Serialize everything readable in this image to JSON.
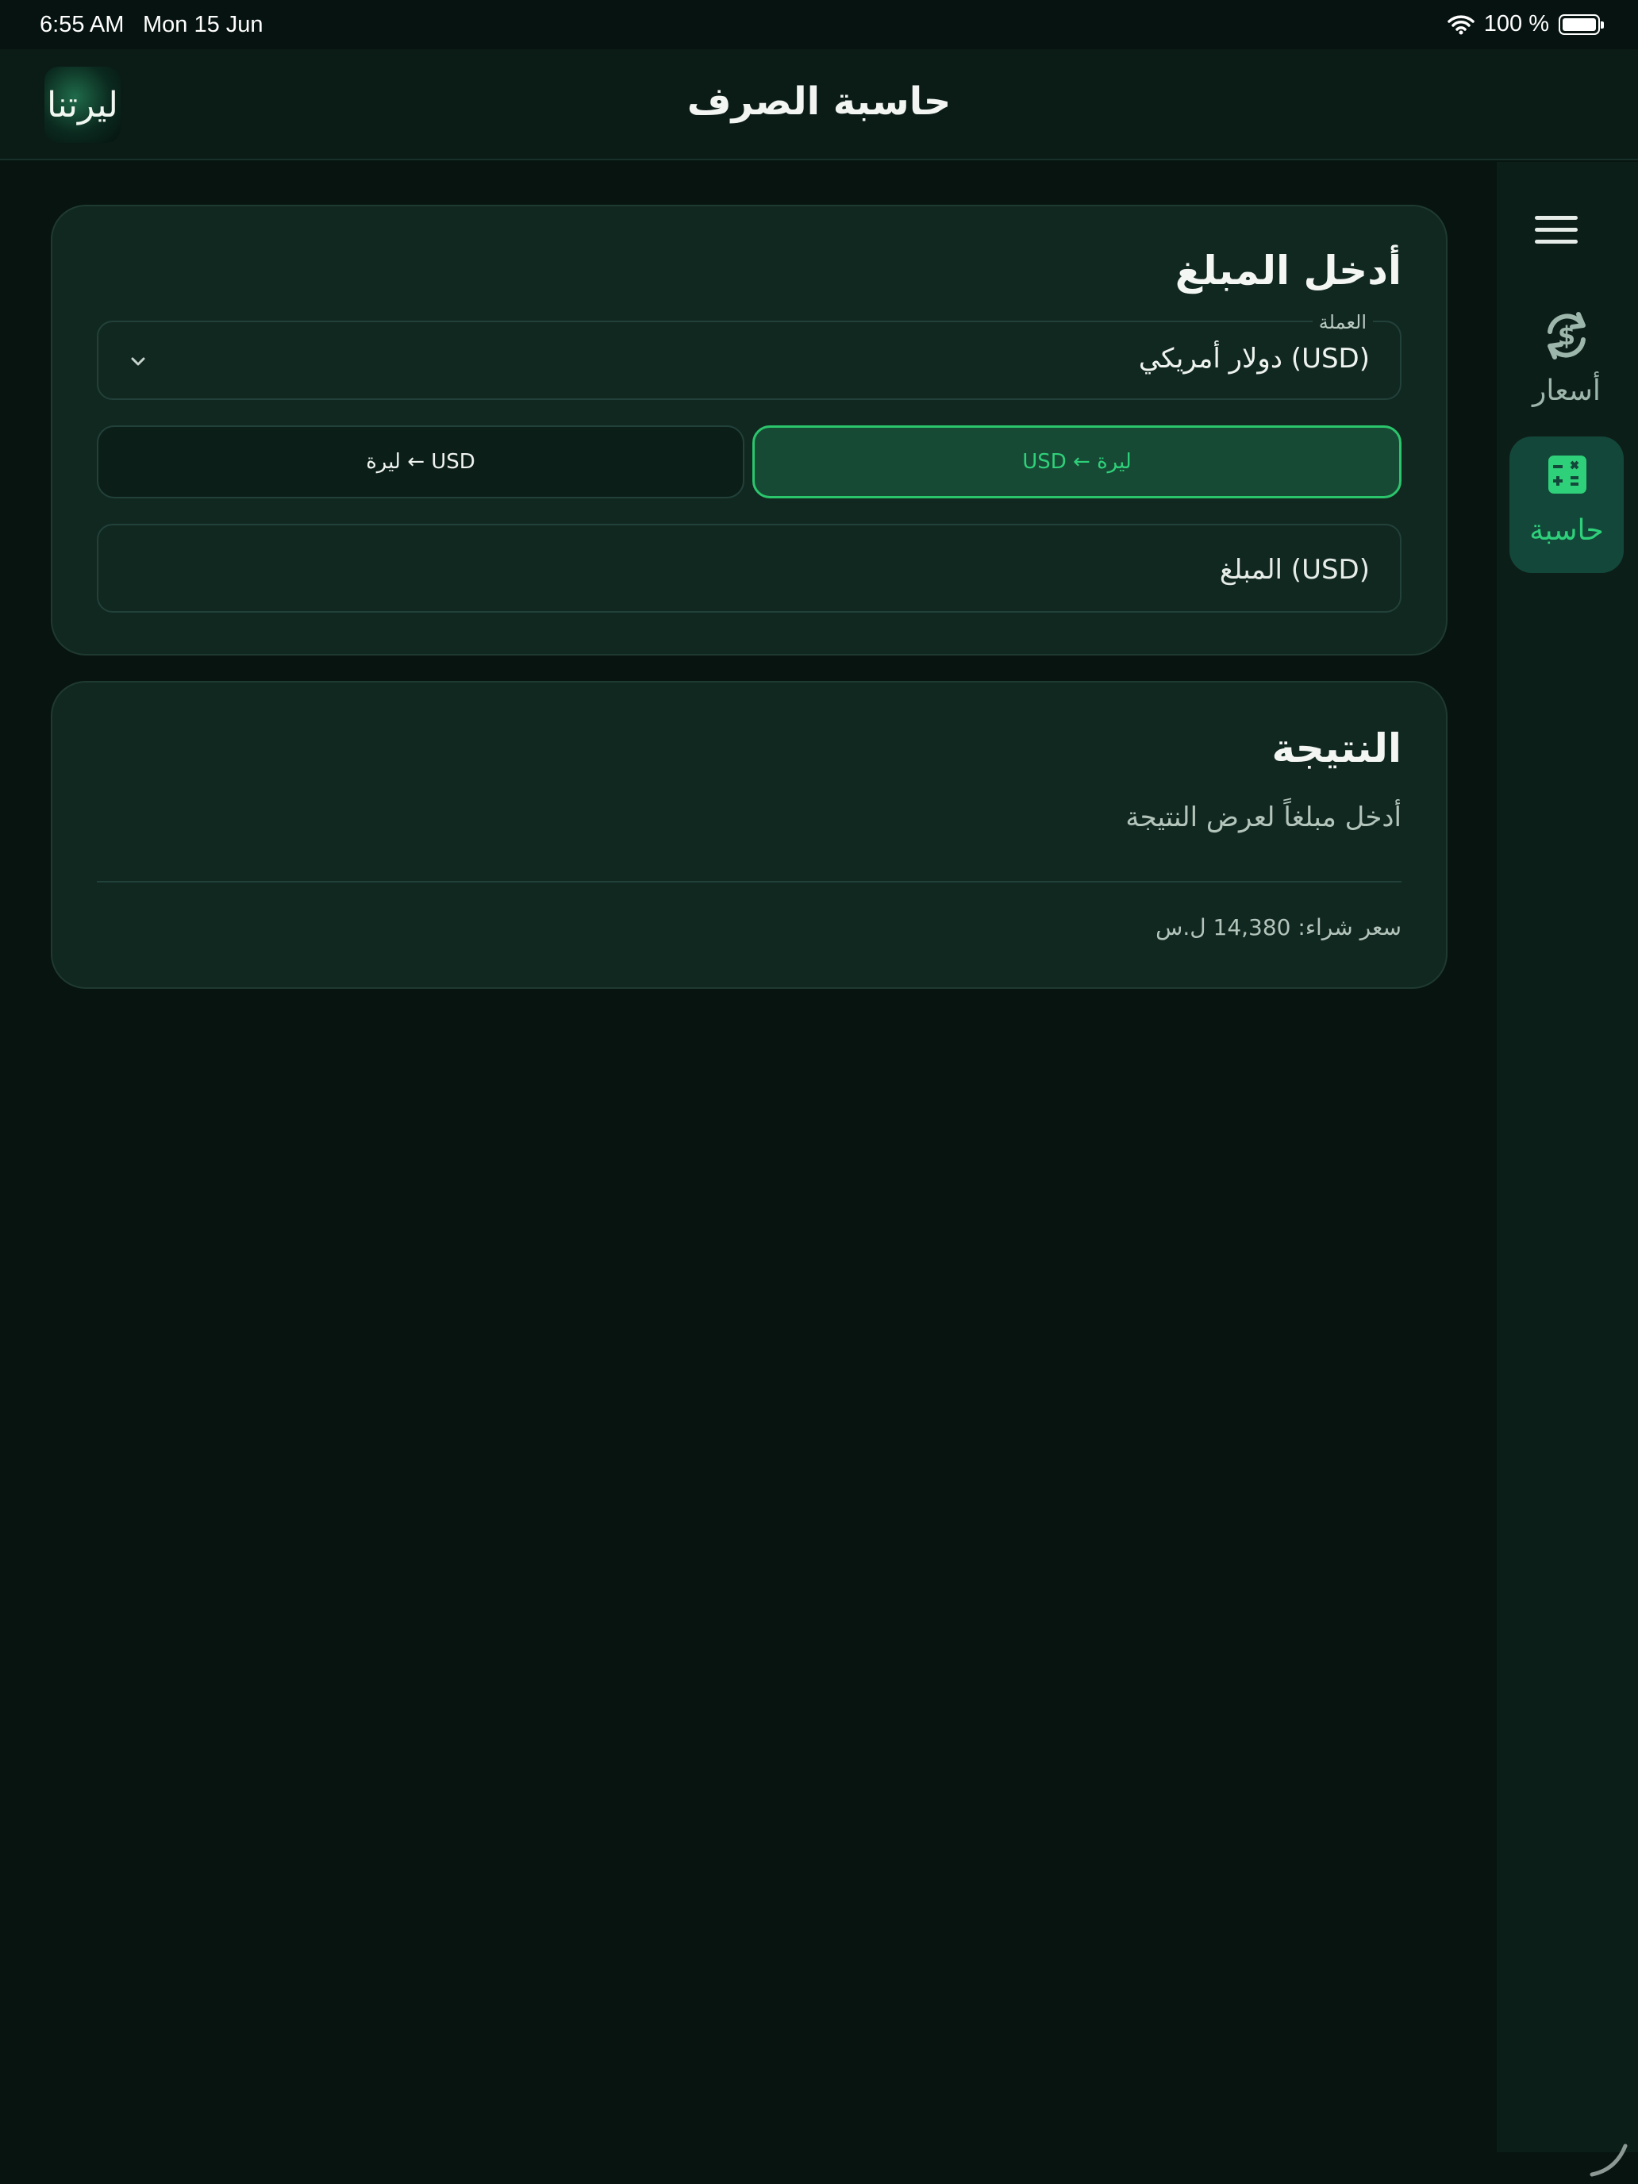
{
  "status_bar": {
    "time": "6:55 AM",
    "date": "Mon 15 Jun",
    "battery": "100 %"
  },
  "header": {
    "title": "حاسبة الصرف",
    "logo_text": "ليرتنا"
  },
  "side_rail": {
    "items": [
      {
        "label": "أسعار",
        "icon": "dollar-exchange-icon"
      },
      {
        "label": "حاسبة",
        "icon": "calculator-icon",
        "active": true
      }
    ]
  },
  "input_card": {
    "title": "أدخل المبلغ",
    "currency_legend": "العملة",
    "currency_value": "دولار أمريكي (USD)",
    "direction_active": "USD ← ليرة",
    "direction_inactive": "ليرة ← USD",
    "amount_placeholder": "المبلغ (USD)"
  },
  "result_card": {
    "title": "النتيجة",
    "hint": "أدخل مبلغاً لعرض النتيجة",
    "buy_rate": "سعر شراء: 14,380 ل.س"
  },
  "colors": {
    "background": "#07140f",
    "card": "#112820",
    "accent": "#2fd07a"
  }
}
